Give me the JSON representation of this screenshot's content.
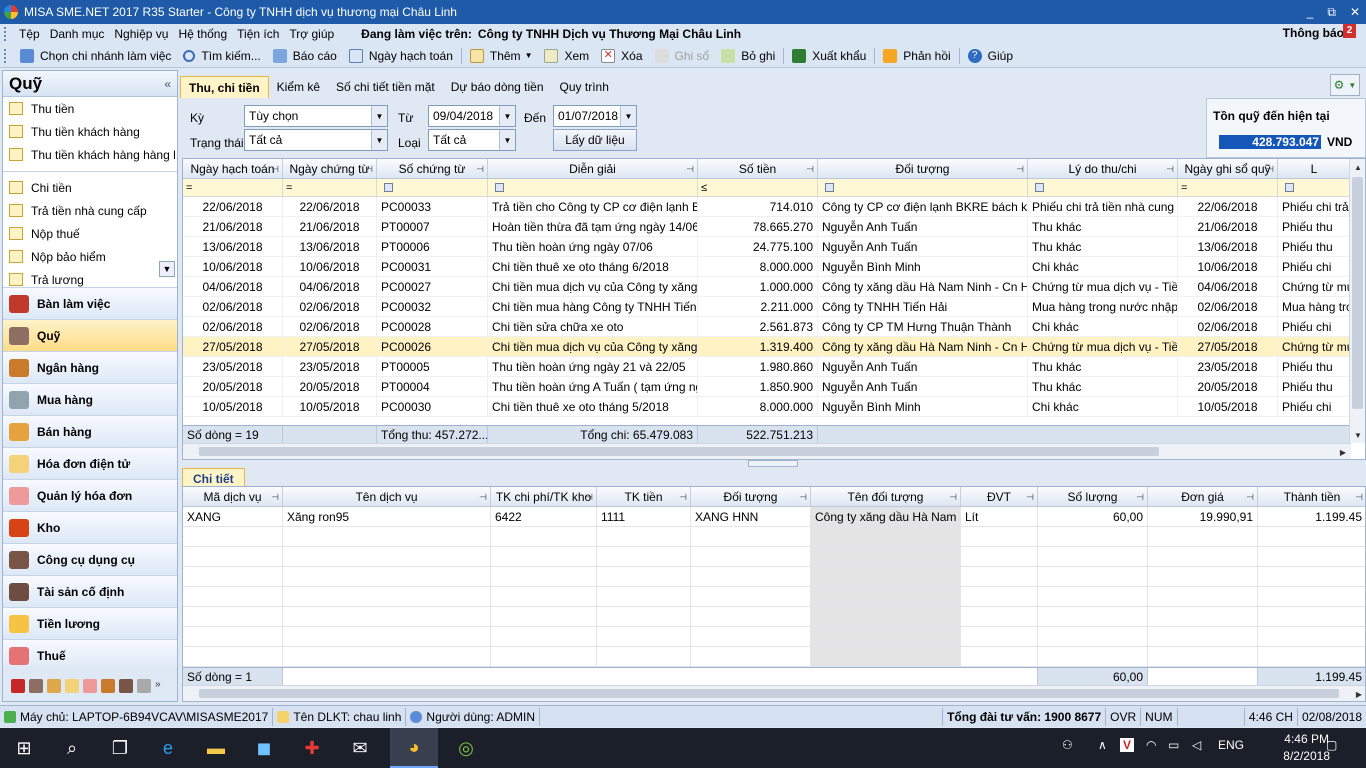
{
  "titlebar": {
    "title": "MISA SME.NET 2017 R35 Starter - Công ty TNHH dịch vụ thương mại Châu Linh",
    "minimize": "_",
    "restore": "⧉",
    "close": "✕"
  },
  "menu": {
    "items": [
      "Tệp",
      "Danh mục",
      "Nghiệp vụ",
      "Hệ thống",
      "Tiện ích",
      "Trợ giúp"
    ],
    "working_label": "Đang làm việc trên:",
    "working_value": "Công ty TNHH Dịch vụ Thương Mại Châu Linh",
    "notification_label": "Thông báo",
    "notification_count": "2"
  },
  "toolbar": {
    "branch": "Chọn chi nhánh làm việc",
    "search": "Tìm kiếm...",
    "report": "Báo cáo",
    "posting_date": "Ngày hạch toán",
    "add": "Thêm",
    "view": "Xem",
    "delete": "Xóa",
    "post": "Ghi sổ",
    "unpost": "Bỏ ghi",
    "export": "Xuất khẩu",
    "feedback": "Phản hồi",
    "help": "Giúp"
  },
  "sidebar": {
    "title": "Quỹ",
    "collapse": "«",
    "group1": [
      "Thu tiền",
      "Thu tiền khách hàng",
      "Thu tiền khách hàng hàng l..."
    ],
    "group2": [
      "Chi tiền",
      "Trả tiền nhà cung cấp",
      "Nộp thuế",
      "Nộp bảo hiểm",
      "Trả lương"
    ],
    "modules": [
      "Bàn làm việc",
      "Quỹ",
      "Ngân hàng",
      "Mua hàng",
      "Bán hàng",
      "Hóa đơn điện tử",
      "Quản lý hóa đơn",
      "Kho",
      "Công cụ dụng cụ",
      "Tài sản cố định",
      "Tiền lương",
      "Thuế"
    ],
    "active_module": "Quỹ"
  },
  "tabs": [
    "Thu, chi tiền",
    "Kiểm kê",
    "Số chi tiết tiền mặt",
    "Dự báo dòng tiền",
    "Quy trình"
  ],
  "filter": {
    "period_label": "Kỳ",
    "period_value": "Tùy chọn",
    "status_label": "Trạng thái",
    "status_value": "Tất cả",
    "from_label": "Từ",
    "from_value": "09/04/2018",
    "to_label": "Đến",
    "to_value": "01/07/2018",
    "type_label": "Loại",
    "type_value": "Tất cả",
    "fetch_button": "Lấy dữ liệu"
  },
  "balance": {
    "label": "Tồn quỹ đến hiện tại",
    "value": "428.793.047",
    "currency": "VND"
  },
  "master_grid": {
    "columns": [
      "Ngày hạch toán",
      "Ngày chứng từ",
      "Số chứng từ",
      "Diễn giải",
      "Số tiền",
      "Đối tượng",
      "Lý do thu/chi",
      "Ngày ghi sổ quỹ",
      "L"
    ],
    "filter_ops": [
      "=",
      "=",
      "",
      "",
      "≤",
      "",
      "",
      "=",
      ""
    ],
    "rows": [
      [
        "22/06/2018",
        "22/06/2018",
        "PC00033",
        "Trả tiền cho Công ty CP cơ điện lạnh B",
        "714.010",
        "Công ty CP cơ điện lạnh BKRE bách kh",
        "Phiếu chi trả tiền nhà cung",
        "22/06/2018",
        "Phiếu chi trả t"
      ],
      [
        "21/06/2018",
        "21/06/2018",
        "PT00007",
        "Hoàn tiền thừa đã tạm ứng ngày 14/06",
        "78.665.270",
        "Nguyễn Anh Tuấn",
        "Thu khác",
        "21/06/2018",
        "Phiếu thu"
      ],
      [
        "13/06/2018",
        "13/06/2018",
        "PT00006",
        "Thu tiền hoàn ứng ngày 07/06",
        "24.775.100",
        "Nguyễn Anh Tuấn",
        "Thu khác",
        "13/06/2018",
        "Phiếu thu"
      ],
      [
        "10/06/2018",
        "10/06/2018",
        "PC00031",
        "Chi tiền thuê xe oto tháng 6/2018",
        "8.000.000",
        "Nguyễn Bình Minh",
        "Chi khác",
        "10/06/2018",
        "Phiếu chi"
      ],
      [
        "04/06/2018",
        "04/06/2018",
        "PC00027",
        "Chi tiền mua dịch vụ của Công ty xăng",
        "1.000.000",
        "Công ty xăng dầu Hà Nam Ninh - Cn Hà",
        "Chứng từ mua dịch vụ  - Tiề",
        "04/06/2018",
        "Chứng từ mua"
      ],
      [
        "02/06/2018",
        "02/06/2018",
        "PC00032",
        "Chi tiền mua hàng Công ty TNHH Tiến",
        "2.211.000",
        "Công ty TNHH Tiến Hải",
        "Mua hàng trong nước nhập",
        "02/06/2018",
        "Mua hàng tron"
      ],
      [
        "02/06/2018",
        "02/06/2018",
        "PC00028",
        "Chi tiền sửa chữa xe oto",
        "2.561.873",
        "Công ty CP TM  Hưng Thuận Thành",
        "Chi khác",
        "02/06/2018",
        "Phiếu chi"
      ],
      [
        "27/05/2018",
        "27/05/2018",
        "PC00026",
        "Chi tiền mua dịch vụ của Công ty xăng",
        "1.319.400",
        "Công ty xăng dầu Hà Nam Ninh - Cn Hà",
        "Chứng từ mua dịch vụ  - Tiề",
        "27/05/2018",
        "Chứng từ mua"
      ],
      [
        "23/05/2018",
        "23/05/2018",
        "PT00005",
        "Thu tiền hoàn ứng ngày 21 và 22/05",
        "1.980.860",
        "Nguyễn Anh Tuấn",
        "Thu khác",
        "23/05/2018",
        "Phiếu thu"
      ],
      [
        "20/05/2018",
        "20/05/2018",
        "PT00004",
        "Thu tiền hoàn ứng A Tuấn ( tạm ứng ng",
        "1.850.900",
        "Nguyễn Anh Tuấn",
        "Thu khác",
        "20/05/2018",
        "Phiếu thu"
      ],
      [
        "10/05/2018",
        "10/05/2018",
        "PC00030",
        "Chi tiền thuê xe oto tháng 5/2018",
        "8.000.000",
        "Nguyễn Bình Minh",
        "Chi khác",
        "10/05/2018",
        "Phiếu chi"
      ]
    ],
    "selected_row": 7,
    "summary": {
      "count": "Số dòng = 19",
      "total_in": "Tổng thu: 457.272....",
      "total_out": "Tổng chi: 65.479.083",
      "total": "522.751.213"
    }
  },
  "detail": {
    "tab": "Chi tiết",
    "columns": [
      "Mã dịch vụ",
      "Tên dịch vụ",
      "TK chi phí/TK kho",
      "TK tiền",
      "Đối tượng",
      "Tên đối tượng",
      "ĐVT",
      "Số lượng",
      "Đơn giá",
      "Thành tiền"
    ],
    "rows": [
      [
        "XANG",
        "Xăng ron95",
        "6422",
        "1111",
        "XANG HNN",
        "Công ty xăng dầu Hà Nam",
        "Lít",
        "60,00",
        "19.990,91",
        "1.199.45"
      ]
    ],
    "summary": {
      "count": "Số dòng = 1",
      "quantity": "60,00",
      "amount": "1.199.45"
    }
  },
  "statusbar": {
    "server": "Máy chủ: LAPTOP-6B94VCAV\\MISASME2017",
    "db": "Tên DLKT: chau linh",
    "user": "Người dùng: ADMIN",
    "hotline": "Tổng đài tư vấn: 1900 8677",
    "ovr": "OVR",
    "num": "NUM",
    "time": "4:46 CH",
    "date": "02/08/2018"
  },
  "taskbar": {
    "lang": "ENG",
    "clock_time": "4:46 PM",
    "clock_date": "8/2/2018"
  },
  "colors": {
    "titlebar": "#1e5aa8",
    "selected_row": "#fff3c4",
    "balance_bg": "#1557b8",
    "active_tab": "#fff4c8"
  }
}
